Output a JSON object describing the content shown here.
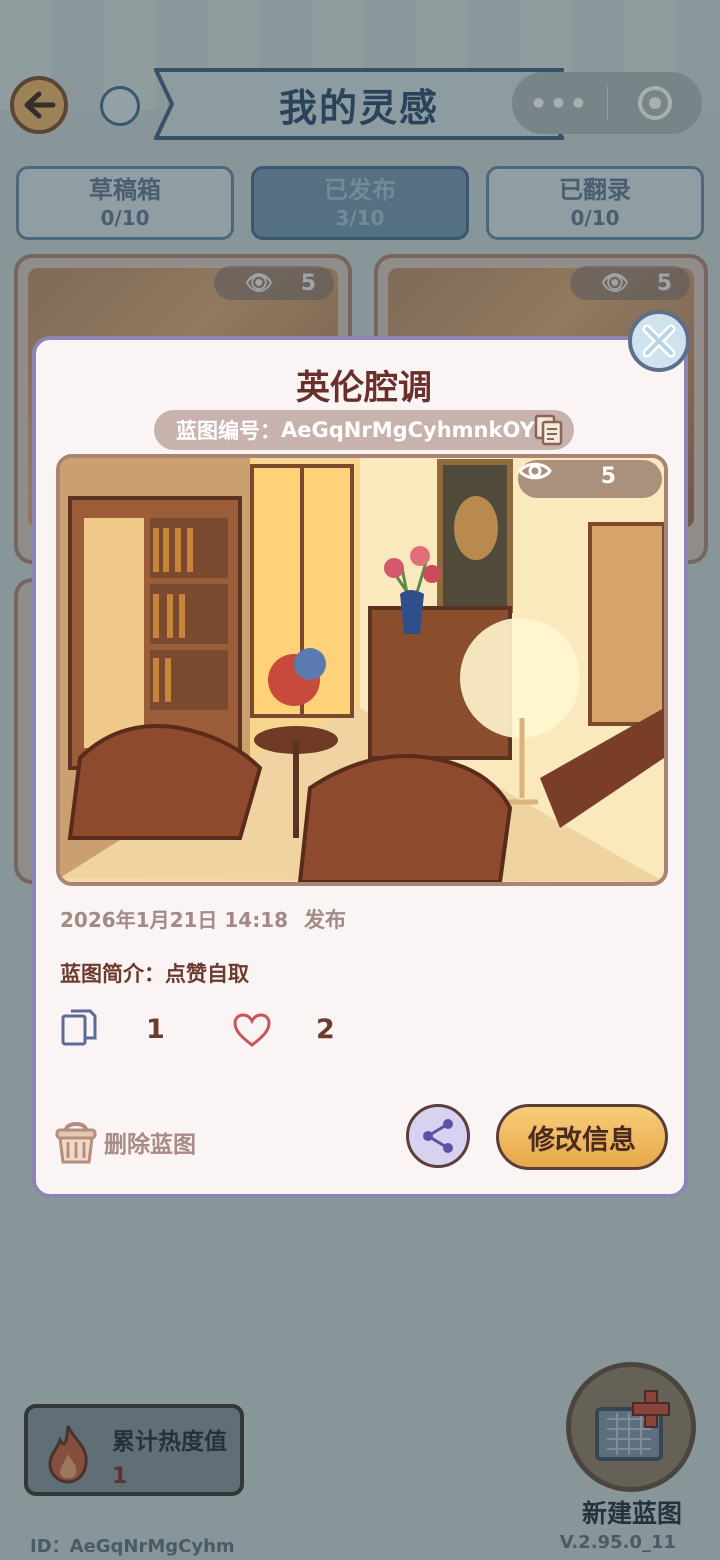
{
  "header": {
    "title": "我的灵感",
    "back_icon": "back-arrow-icon",
    "scroll_icon": "scroll-icon",
    "more_label": "•••",
    "target_icon": "target-icon"
  },
  "tabs": [
    {
      "label": "草稿箱",
      "count": "0/10",
      "active": false
    },
    {
      "label": "已发布",
      "count": "3/10",
      "active": true
    },
    {
      "label": "已翻录",
      "count": "0/10",
      "active": false
    }
  ],
  "grid_cards": [
    {
      "views": "5"
    },
    {
      "views": "5"
    }
  ],
  "modal": {
    "title": "英伦腔调",
    "code_label": "蓝图编号：",
    "code_value": "AeGqNrMgCyhmnkOY",
    "views": "5",
    "publish_date": "2026年1月21日 14:18",
    "publish_label": "发布",
    "intro_label": "蓝图简介：",
    "intro_text": "点赞自取",
    "copies": "1",
    "likes": "2",
    "delete_label": "删除蓝图",
    "edit_label": "修改信息"
  },
  "bottom": {
    "heat_label": "累计热度值",
    "heat_value": "1",
    "new_blueprint_label": "新建蓝图",
    "footer_id": "ID：AeGqNrMgCyhm",
    "version": "V.2.95.0_11"
  },
  "colors": {
    "title_navy": "#23476a",
    "modal_bg": "#fbf4f4",
    "accent_brown": "#6a2f2b",
    "edit_button": "#f3be64"
  }
}
